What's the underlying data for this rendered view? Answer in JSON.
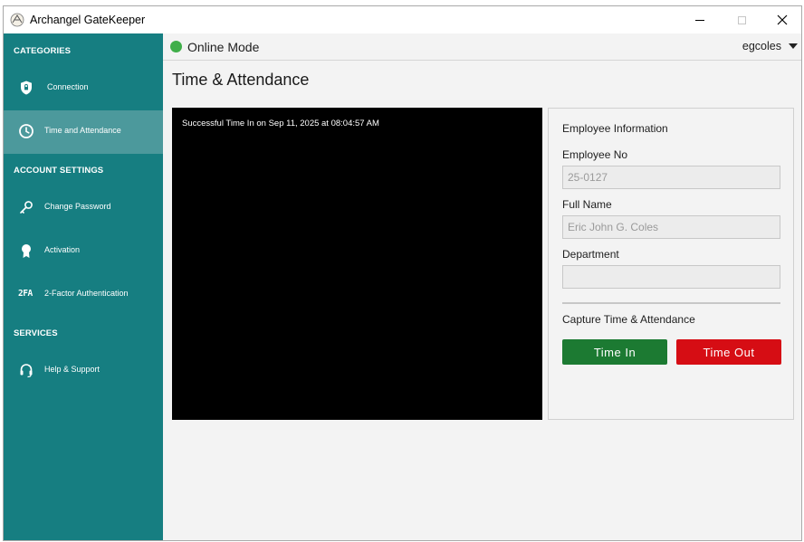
{
  "window": {
    "title": "Archangel GateKeeper"
  },
  "sidebar": {
    "categories_heading": "CATEGORIES",
    "account_heading": "ACCOUNT SETTINGS",
    "services_heading": "SERVICES",
    "items": [
      {
        "label": "Connection",
        "icon": "shield-icon"
      },
      {
        "label": "Time and Attendance",
        "icon": "clock-icon",
        "active": true
      },
      {
        "label": "Change Password",
        "icon": "key-icon"
      },
      {
        "label": "Activation",
        "icon": "ribbon-icon"
      },
      {
        "label": "2-Factor Authentication",
        "icon": "2fa-icon",
        "icon_text": "2FA"
      },
      {
        "label": "Help & Support",
        "icon": "headset-icon"
      }
    ]
  },
  "topbar": {
    "status": "Online Mode",
    "status_color": "#3fae49",
    "username": "egcoles"
  },
  "page": {
    "title": "Time & Attendance"
  },
  "camera": {
    "message": "Successful Time In on Sep 11, 2025 at 08:04:57 AM"
  },
  "employee": {
    "heading": "Employee Information",
    "employee_no_label": "Employee No",
    "employee_no": "25-0127",
    "full_name_label": "Full Name",
    "full_name": "Eric John G. Coles",
    "department_label": "Department",
    "department": ""
  },
  "capture": {
    "heading": "Capture Time & Attendance",
    "time_in_label": "Time In",
    "time_out_label": "Time Out",
    "time_in_color": "#1c7a32",
    "time_out_color": "#d60d14"
  },
  "colors": {
    "sidebar": "#167e81",
    "sidebar_active": "#4c999c"
  }
}
